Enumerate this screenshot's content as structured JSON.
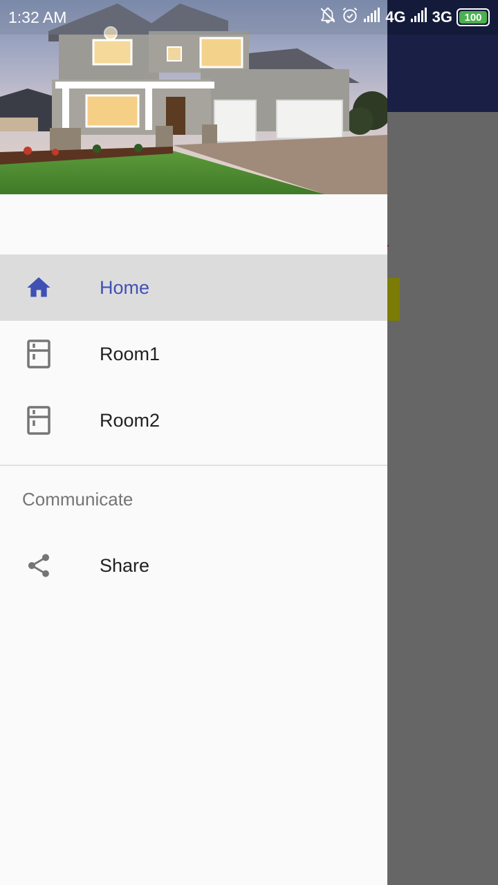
{
  "status_bar": {
    "time": "1:32 AM",
    "network_1": "4G",
    "network_2": "3G",
    "battery_level": "100",
    "icons": [
      "notifications-off-icon",
      "alarm-icon",
      "signal-icon",
      "signal-icon",
      "battery-icon"
    ]
  },
  "drawer": {
    "header_image": "house-photo",
    "items": [
      {
        "label": "Home",
        "icon": "home-icon",
        "selected": true
      },
      {
        "label": "Room1",
        "icon": "fridge-icon",
        "selected": false
      },
      {
        "label": "Room2",
        "icon": "fridge-icon",
        "selected": false
      }
    ],
    "section_title": "Communicate",
    "section_items": [
      {
        "label": "Share",
        "icon": "share-icon"
      }
    ]
  },
  "colors": {
    "accent": "#3f51b5",
    "toolbar": "#1a1f45",
    "scrim": "#666666",
    "selected_bg": "#dcdcdc"
  }
}
